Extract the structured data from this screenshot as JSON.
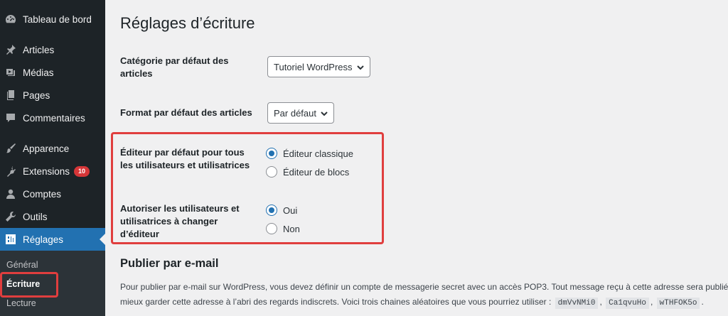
{
  "sidebar": {
    "items": [
      {
        "label": "Tableau de bord",
        "icon": "dashboard-icon"
      },
      {
        "label": "Articles",
        "icon": "pin-icon"
      },
      {
        "label": "Médias",
        "icon": "media-icon"
      },
      {
        "label": "Pages",
        "icon": "pages-icon"
      },
      {
        "label": "Commentaires",
        "icon": "comment-icon"
      },
      {
        "label": "Apparence",
        "icon": "brush-icon"
      },
      {
        "label": "Extensions",
        "icon": "plugin-icon",
        "badge": "10"
      },
      {
        "label": "Comptes",
        "icon": "user-icon"
      },
      {
        "label": "Outils",
        "icon": "wrench-icon"
      },
      {
        "label": "Réglages",
        "icon": "settings-icon",
        "active": true
      }
    ],
    "submenu": [
      "Général",
      "Écriture",
      "Lecture"
    ],
    "current_submenu": "Écriture"
  },
  "page": {
    "title": "Réglages d’écriture",
    "default_category_label": "Catégorie par défaut des articles",
    "default_category_value": "Tutoriel WordPress",
    "default_format_label": "Format par défaut des articles",
    "default_format_value": "Par défaut",
    "default_editor_label": "Éditeur par défaut pour tous les utilisateurs et utilisatrices",
    "editor_options": [
      "Éditeur classique",
      "Éditeur de blocs"
    ],
    "editor_selected": "Éditeur classique",
    "allow_switch_label": "Autoriser les utilisateurs et utilisatrices à changer d’éditeur",
    "switch_options": [
      "Oui",
      "Non"
    ],
    "switch_selected": "Oui",
    "email_section_title": "Publier par e-mail",
    "email_desc_line1": "Pour publier par e-mail sur WordPress, vous devez définir un compte de messagerie secret avec un accès POP3. Tout message reçu à cette adresse sera publié.",
    "email_desc_line2": "mieux garder cette adresse à l’abri des regards indiscrets. Voici trois chaines aléatoires que vous pourriez utiliser :",
    "random_strings": [
      "dmVvNMi0",
      "Ca1qvuHo",
      "wTHFOK5o"
    ],
    "sep1": ",",
    "sep2": ",",
    "end_dot": "."
  },
  "colors": {
    "sidebar_bg": "#1d2327",
    "active_bg": "#2271b1",
    "badge_bg": "#d63638",
    "highlight": "#e03e3e"
  }
}
